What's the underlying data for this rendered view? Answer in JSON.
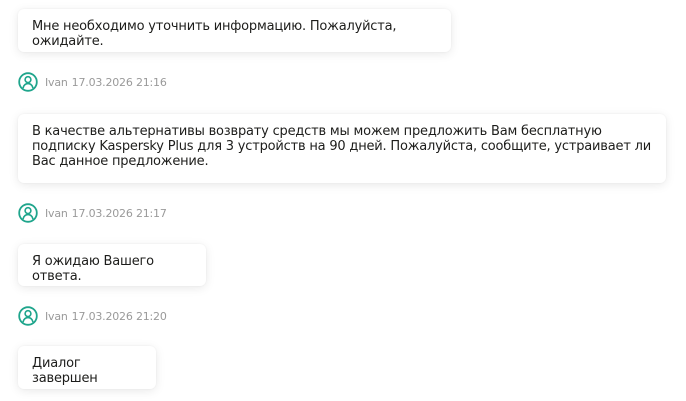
{
  "messages": [
    {
      "type": "bubble",
      "text": "Мне необходимо уточнить информацию. Пожалуйста, ожидайте."
    },
    {
      "type": "meta",
      "author": "Ivan",
      "timestamp": "17.03.2026 21:16",
      "icon": "user-avatar-icon"
    },
    {
      "type": "bubble",
      "text": "В качестве альтернативы возврату средств мы можем предложить Вам бесплатную подписку Kaspersky Plus для 3 устройств на 90 дней. Пожалуйста, сообщите, устраивает ли Вас данное предложение."
    },
    {
      "type": "meta",
      "author": "Ivan",
      "timestamp": "17.03.2026 21:17",
      "icon": "user-avatar-icon"
    },
    {
      "type": "bubble",
      "text": "Я ожидаю Вашего ответа."
    },
    {
      "type": "meta",
      "author": "Ivan",
      "timestamp": "17.03.2026 21:20",
      "icon": "user-avatar-icon"
    },
    {
      "type": "bubble",
      "text": "Диалог завершен"
    }
  ],
  "colors": {
    "accent": "#1fa58c",
    "meta_text": "#9a9a9a",
    "bubble_background": "#ffffff",
    "message_text": "#1d1d1b"
  }
}
